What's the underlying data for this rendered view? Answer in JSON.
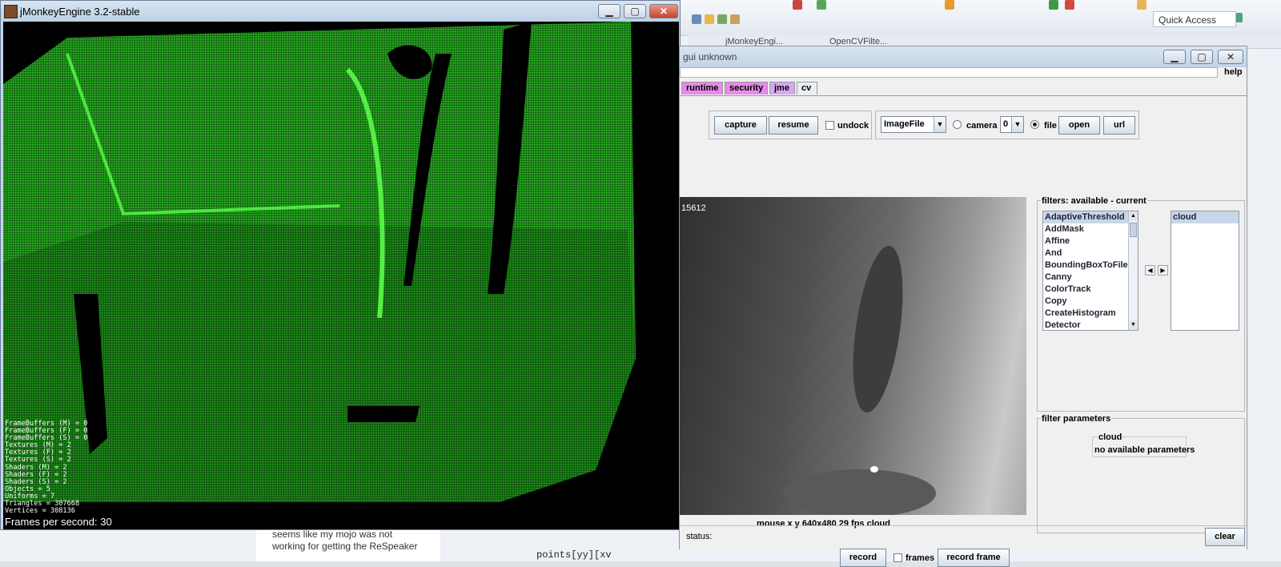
{
  "ide": {
    "quick_access": "Quick Access",
    "tabs": [
      "jMonkeyEngi...",
      "OpenCVFilte..."
    ],
    "bottom_text": [
      "seems like my mojo was not",
      "working for getting the ReSpeaker"
    ],
    "code_snippet": "points[yy][xv"
  },
  "jme": {
    "title": "jMonkeyEngine 3.2-stable",
    "stats": [
      "FrameBuffers (M) = 0",
      "FrameBuffers (F) = 0",
      "FrameBuffers (S) = 0",
      "Textures (M) = 2",
      "Textures (F) = 2",
      "Textures (S) = 2",
      "Shaders (M) = 2",
      "Shaders (F) = 2",
      "Shaders (S) = 2",
      "Objects = 5",
      "Uniforms = 7",
      "Triangles = 307668",
      "Vertices = 308136"
    ],
    "fps": "Frames per second: 30",
    "controls": {
      "minimize": "▁",
      "maximize": "▢",
      "close": "✕"
    }
  },
  "gui": {
    "title": "gui unknown",
    "help": "help",
    "tabs": [
      {
        "label": "runtime",
        "color": "#e58be8"
      },
      {
        "label": "security",
        "color": "#e58be8"
      },
      {
        "label": "jme",
        "color": "#d7a8f0"
      },
      {
        "label": "cv",
        "color": "#e9eef5"
      }
    ],
    "capture": "capture",
    "resume": "resume",
    "undock": "undock",
    "source_select": "ImageFile",
    "camera": "camera",
    "camera_index": "0",
    "file": "file",
    "open": "open",
    "url": "url",
    "frame_number": "15612",
    "image_status": "mouse x y  640x480  29 fps  cloud",
    "filters_title": "filters: available - current",
    "available_filters": [
      "AdaptiveThreshold",
      "AddMask",
      "Affine",
      "And",
      "BoundingBoxToFile",
      "Canny",
      "ColorTrack",
      "Copy",
      "CreateHistogram",
      "Detector"
    ],
    "current_filters": [
      "cloud"
    ],
    "filter_params_title": "filter parameters",
    "param_group": "cloud",
    "param_text": "no available parameters",
    "record": "record",
    "frames": "frames",
    "record_frame": "record frame",
    "status_label": "status:",
    "clear": "clear"
  }
}
